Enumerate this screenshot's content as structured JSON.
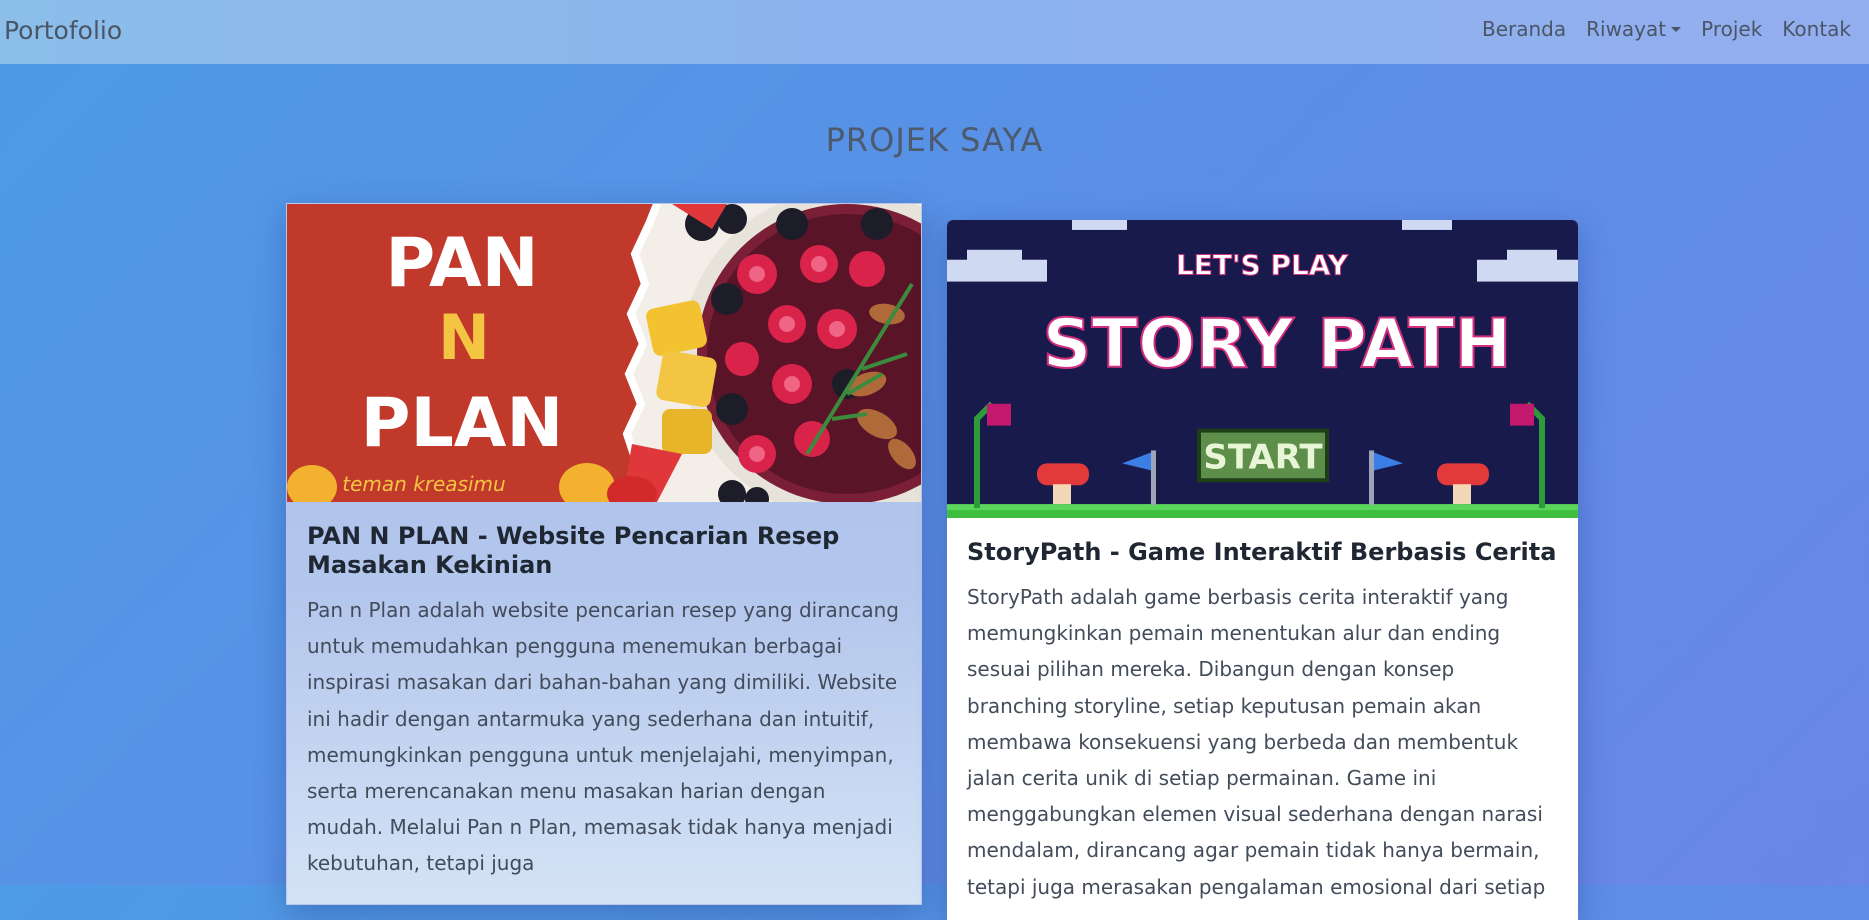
{
  "navbar": {
    "brand": "Portofolio",
    "links": [
      "Beranda",
      "Riwayat",
      "Projek",
      "Kontak"
    ]
  },
  "section": {
    "title": "PROJEK SAYA"
  },
  "projects": [
    {
      "title": "PAN N PLAN - Website Pencarian Resep Masakan Kekinian",
      "description": "Pan n Plan adalah website pencarian resep yang dirancang untuk memudahkan pengguna menemukan berbagai inspirasi masakan dari bahan-bahan yang dimiliki. Website ini hadir dengan antarmuka yang sederhana dan intuitif, memungkinkan pengguna untuk menjelajahi, menyimpan, serta merencanakan menu masakan harian dengan mudah. Melalui Pan n Plan, memasak tidak hanya menjadi kebutuhan, tetapi juga",
      "image": {
        "logo_line1": "PAN",
        "logo_line2": "N",
        "logo_line3": "PLAN",
        "tagline": "teman kreasimu"
      }
    },
    {
      "title": "StoryPath - Game Interaktif Berbasis Cerita",
      "description": "StoryPath adalah game berbasis cerita interaktif yang memungkinkan pemain menentukan alur dan ending sesuai pilihan mereka. Dibangun dengan konsep branching storyline, setiap keputusan pemain akan membawa konsekuensi yang berbeda dan membentuk jalan cerita unik di setiap permainan. Game ini menggabungkan elemen visual sederhana dengan narasi mendalam, dirancang agar pemain tidak hanya bermain, tetapi juga merasakan pengalaman emosional dari setiap",
      "image": {
        "subtitle": "LET'S PLAY",
        "title": "STORY PATH",
        "button": "START"
      }
    }
  ],
  "colors": {
    "pan_red": "#c0392b",
    "pan_yellow": "#f4c542",
    "game_navy": "#181a4c",
    "game_grass": "#3fbf3f"
  }
}
